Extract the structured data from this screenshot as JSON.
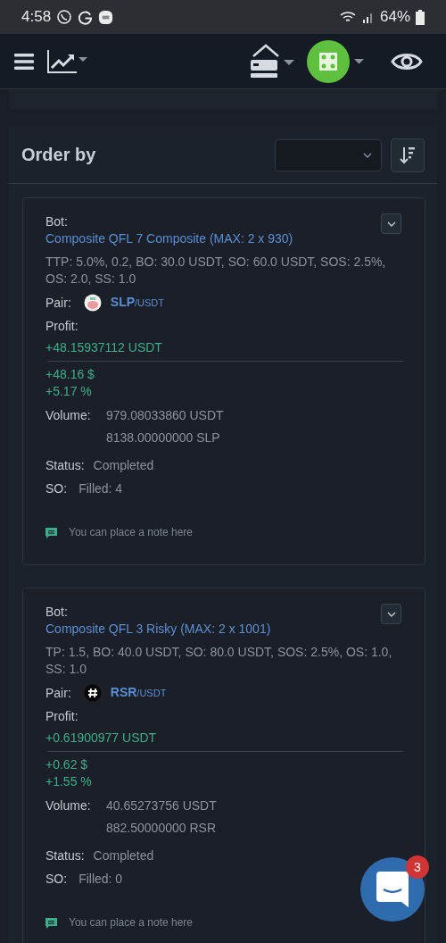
{
  "status_bar": {
    "time": "4:58",
    "battery": "64%"
  },
  "order_panel": {
    "title": "Order by"
  },
  "deals": [
    {
      "bot_label": "Bot:",
      "bot_name": "Composite QFL 7 Composite (MAX: 2 x 930)",
      "params": "TTP: 5.0%, 0.2, BO: 30.0 USDT, SO: 60.0 USDT, SOS: 2.5%, OS: 2.0, SS: 1.0",
      "pair_label": "Pair:",
      "base": "SLP",
      "quote": "/USDT",
      "profit_label": "Profit:",
      "profit_value": "+48.15937112 USDT",
      "profit_usd": "+48.16 $",
      "profit_percent": "+5.17 %",
      "volume_label": "Volume:",
      "volumes": [
        "979.08033860 USDT",
        "8138.00000000 SLP"
      ],
      "status_label": "Status:",
      "status": "Completed",
      "so_label": "SO:",
      "so_value": "Filled: 4",
      "note_hint": "You can place a note here"
    },
    {
      "bot_label": "Bot:",
      "bot_name": "Composite QFL 3 Risky (MAX: 2 x 1001)",
      "params": "TP: 1.5, BO: 40.0 USDT, SO: 80.0 USDT, SOS: 2.5%, OS: 1.0, SS: 1.0",
      "pair_label": "Pair:",
      "base": "RSR",
      "quote": "/USDT",
      "profit_label": "Profit:",
      "profit_value": "+0.61900977 USDT",
      "profit_usd": "+0.62 $",
      "profit_percent": "+1.55 %",
      "volume_label": "Volume:",
      "volumes": [
        "40.65273756 USDT",
        "882.50000000 RSR"
      ],
      "status_label": "Status:",
      "status": "Completed",
      "so_label": "SO:",
      "so_value": "Filled: 0",
      "note_hint": "You can place a note here"
    }
  ],
  "chat": {
    "badge": "3"
  }
}
